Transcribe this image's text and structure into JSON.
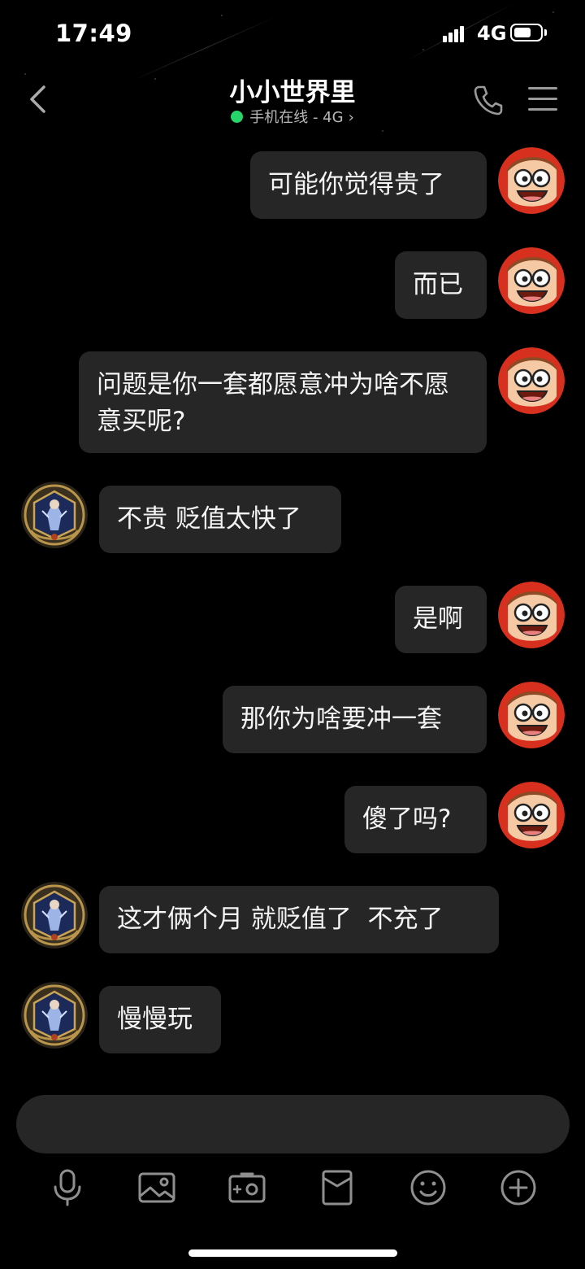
{
  "status_bar": {
    "time": "17:49",
    "network": "4G"
  },
  "header": {
    "back_icon": "chevron-left-icon",
    "title": "小小世界里",
    "status": "手机在线 - 4G",
    "status_color": "#27d56b",
    "call_icon": "phone-icon",
    "menu_icon": "menu-icon"
  },
  "messages": [
    {
      "side": "right",
      "text": "可能你觉得贵了"
    },
    {
      "side": "right",
      "text": "而已"
    },
    {
      "side": "right",
      "text": "问题是你一套都愿意冲为啥不愿意买呢?"
    },
    {
      "side": "left",
      "text": "不贵 贬值太快了"
    },
    {
      "side": "right",
      "text": "是啊"
    },
    {
      "side": "right",
      "text": "那你为啥要冲一套"
    },
    {
      "side": "right",
      "text": "傻了吗?"
    },
    {
      "side": "left",
      "text": "这才俩个月 就贬值了  不充了"
    },
    {
      "side": "left",
      "text": "慢慢玩"
    }
  ],
  "input": {
    "placeholder": ""
  },
  "toolbar": {
    "items": [
      "microphone-icon",
      "image-icon",
      "camera-icon",
      "red-packet-icon",
      "emoji-icon",
      "plus-icon"
    ]
  },
  "colors": {
    "background": "#000000",
    "bubble": "#262626",
    "online": "#27d56b",
    "my_avatar_bg": "#d8301e"
  }
}
